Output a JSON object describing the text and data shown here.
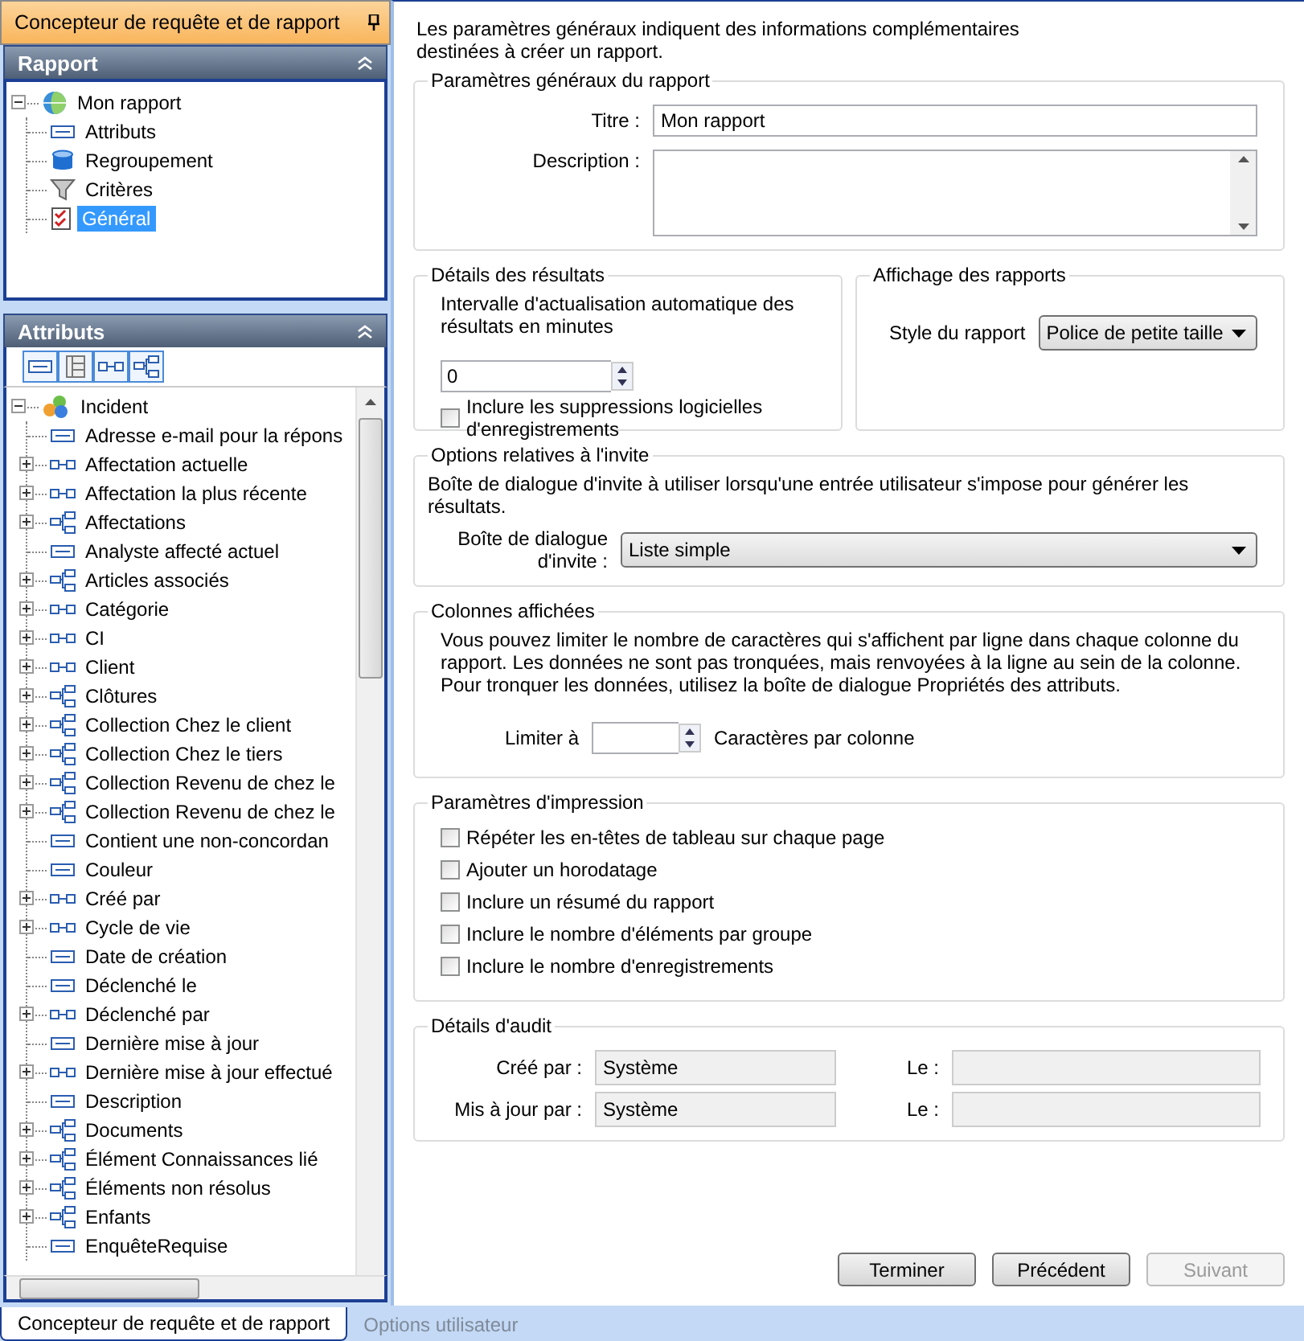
{
  "app_title": "Concepteur de requête et de rapport",
  "report_panel": {
    "title": "Rapport",
    "tree": {
      "label": "Mon rapport",
      "expanded": true,
      "children": [
        {
          "label": "Attributs",
          "kind": "attributes",
          "selected": false
        },
        {
          "label": "Regroupement",
          "kind": "grouping",
          "selected": false
        },
        {
          "label": "Critères",
          "kind": "criteria",
          "selected": false
        },
        {
          "label": "Général",
          "kind": "general",
          "selected": true
        }
      ]
    }
  },
  "attributes_panel": {
    "title": "Attributs",
    "tree": {
      "label": "Incident",
      "expanded": true,
      "children": [
        {
          "label": "Adresse e-mail pour la répons",
          "kind": "field"
        },
        {
          "label": "Affectation actuelle",
          "kind": "reference"
        },
        {
          "label": "Affectation la plus récente",
          "kind": "reference"
        },
        {
          "label": "Affectations",
          "kind": "collection"
        },
        {
          "label": "Analyste affecté actuel",
          "kind": "field"
        },
        {
          "label": "Articles associés",
          "kind": "collection"
        },
        {
          "label": "Catégorie",
          "kind": "reference"
        },
        {
          "label": "CI",
          "kind": "reference"
        },
        {
          "label": "Client",
          "kind": "reference"
        },
        {
          "label": "Clôtures",
          "kind": "collection"
        },
        {
          "label": "Collection Chez le client",
          "kind": "collection"
        },
        {
          "label": "Collection Chez le tiers",
          "kind": "collection"
        },
        {
          "label": "Collection Revenu de chez le",
          "kind": "collection"
        },
        {
          "label": "Collection Revenu de chez le",
          "kind": "collection"
        },
        {
          "label": "Contient une non-concordan",
          "kind": "field"
        },
        {
          "label": "Couleur",
          "kind": "field"
        },
        {
          "label": "Créé par",
          "kind": "reference"
        },
        {
          "label": "Cycle de vie",
          "kind": "reference"
        },
        {
          "label": "Date de création",
          "kind": "field"
        },
        {
          "label": "Déclenché le",
          "kind": "field"
        },
        {
          "label": "Déclenché par",
          "kind": "reference"
        },
        {
          "label": "Dernière mise à jour",
          "kind": "field"
        },
        {
          "label": "Dernière mise à jour effectué",
          "kind": "reference"
        },
        {
          "label": "Description",
          "kind": "field"
        },
        {
          "label": "Documents",
          "kind": "collection"
        },
        {
          "label": "Élément Connaissances lié",
          "kind": "collection"
        },
        {
          "label": "Éléments non résolus",
          "kind": "collection"
        },
        {
          "label": "Enfants",
          "kind": "collection"
        },
        {
          "label": "EnquêteRequise",
          "kind": "field"
        }
      ]
    }
  },
  "intro": "Les paramètres généraux indiquent des informations complémentaires destinées à créer un rapport.",
  "general_group": {
    "title": "Paramètres généraux du rapport",
    "title_label": "Titre :",
    "title_value": "Mon rapport",
    "description_label": "Description :"
  },
  "results_group": {
    "title": "Détails des résultats",
    "text": "Intervalle d'actualisation automatique des résultats en minutes",
    "interval_value": "0",
    "soft_delete": {
      "label": "Inclure les suppressions logicielles d'enregistrements",
      "checked": false
    }
  },
  "display_group": {
    "title": "Affichage des rapports",
    "style_label": "Style du rapport",
    "style_value": "Police de petite taille"
  },
  "prompt_group": {
    "title": "Options relatives à l'invite",
    "text": "Boîte de dialogue d'invite à utiliser lorsqu'une entrée utilisateur s'impose pour générer les résultats.",
    "dialog_label": "Boîte de dialogue d'invite :",
    "dialog_value": "Liste simple"
  },
  "columns_group": {
    "title": "Colonnes affichées",
    "text": "Vous pouvez limiter le nombre de caractères qui s'affichent par ligne dans chaque colonne du rapport. Les données ne sont pas tronquées, mais renvoyées à la ligne au sein de la colonne. Pour tronquer les données, utilisez la boîte de dialogue Propriétés des attributs.",
    "limit_label": "Limiter à",
    "limit_suffix": "Caractères par colonne"
  },
  "print_group": {
    "title": "Paramètres d'impression",
    "options": [
      {
        "label": "Répéter les en-têtes de tableau sur chaque page",
        "checked": false
      },
      {
        "label": "Ajouter un horodatage",
        "checked": false
      },
      {
        "label": "Inclure un résumé du rapport",
        "checked": false
      },
      {
        "label": "Inclure le nombre d'éléments par groupe",
        "checked": false
      },
      {
        "label": "Inclure le nombre d'enregistrements",
        "checked": false
      }
    ]
  },
  "audit_group": {
    "title": "Détails d'audit",
    "created_label": "Créé par :",
    "created_value": "Système",
    "created_on_label": "Le :",
    "updated_label": "Mis à jour par :",
    "updated_value": "Système",
    "updated_on_label": "Le :"
  },
  "buttons": [
    {
      "label": "Terminer",
      "disabled": false
    },
    {
      "label": "Précédent",
      "disabled": false
    },
    {
      "label": "Suivant",
      "disabled": true
    }
  ],
  "bottom_tabs": [
    {
      "label": "Concepteur de requête et de rapport",
      "selected": true
    },
    {
      "label": "Options utilisateur",
      "selected": false
    }
  ]
}
